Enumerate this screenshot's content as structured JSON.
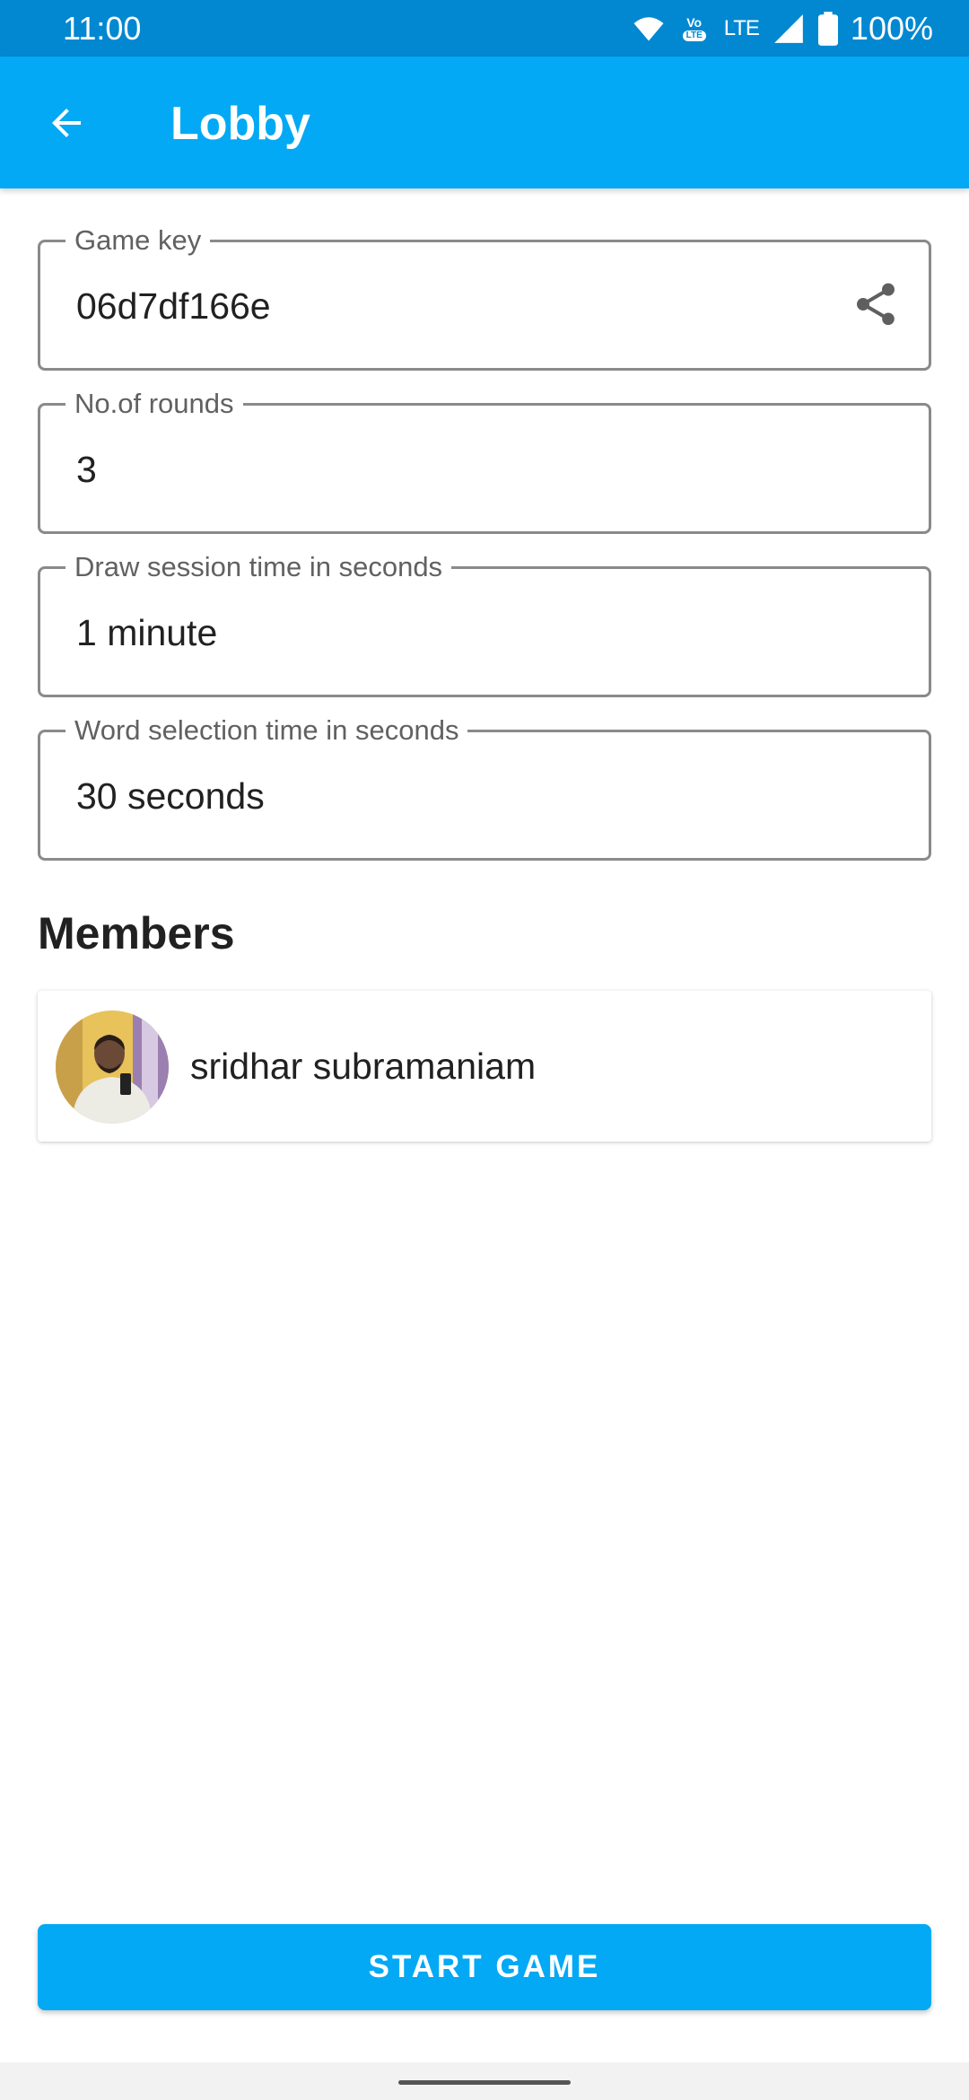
{
  "status_bar": {
    "time": "11:00",
    "volte_label": "Vo",
    "volte_sub": "LTE",
    "network": "LTE",
    "battery": "100%",
    "icons": [
      "wifi-icon",
      "volte-icon",
      "signal-icon",
      "battery-icon"
    ]
  },
  "app_bar": {
    "title": "Lobby",
    "back_icon": "arrow-back-icon",
    "color": "#03a9f4"
  },
  "fields": {
    "game_key": {
      "label": "Game key",
      "value": "06d7df166e",
      "action_icon": "share-icon"
    },
    "rounds": {
      "label": "No.of rounds",
      "value": "3"
    },
    "draw_time": {
      "label": "Draw session time in seconds",
      "value": "1 minute"
    },
    "word_time": {
      "label": "Word selection time in seconds",
      "value": "30 seconds"
    }
  },
  "members": {
    "heading": "Members",
    "items": [
      {
        "name": "sridhar subramaniam",
        "avatar": "user-photo"
      }
    ]
  },
  "actions": {
    "start_label": "START GAME",
    "start_color": "#03a9f4"
  }
}
